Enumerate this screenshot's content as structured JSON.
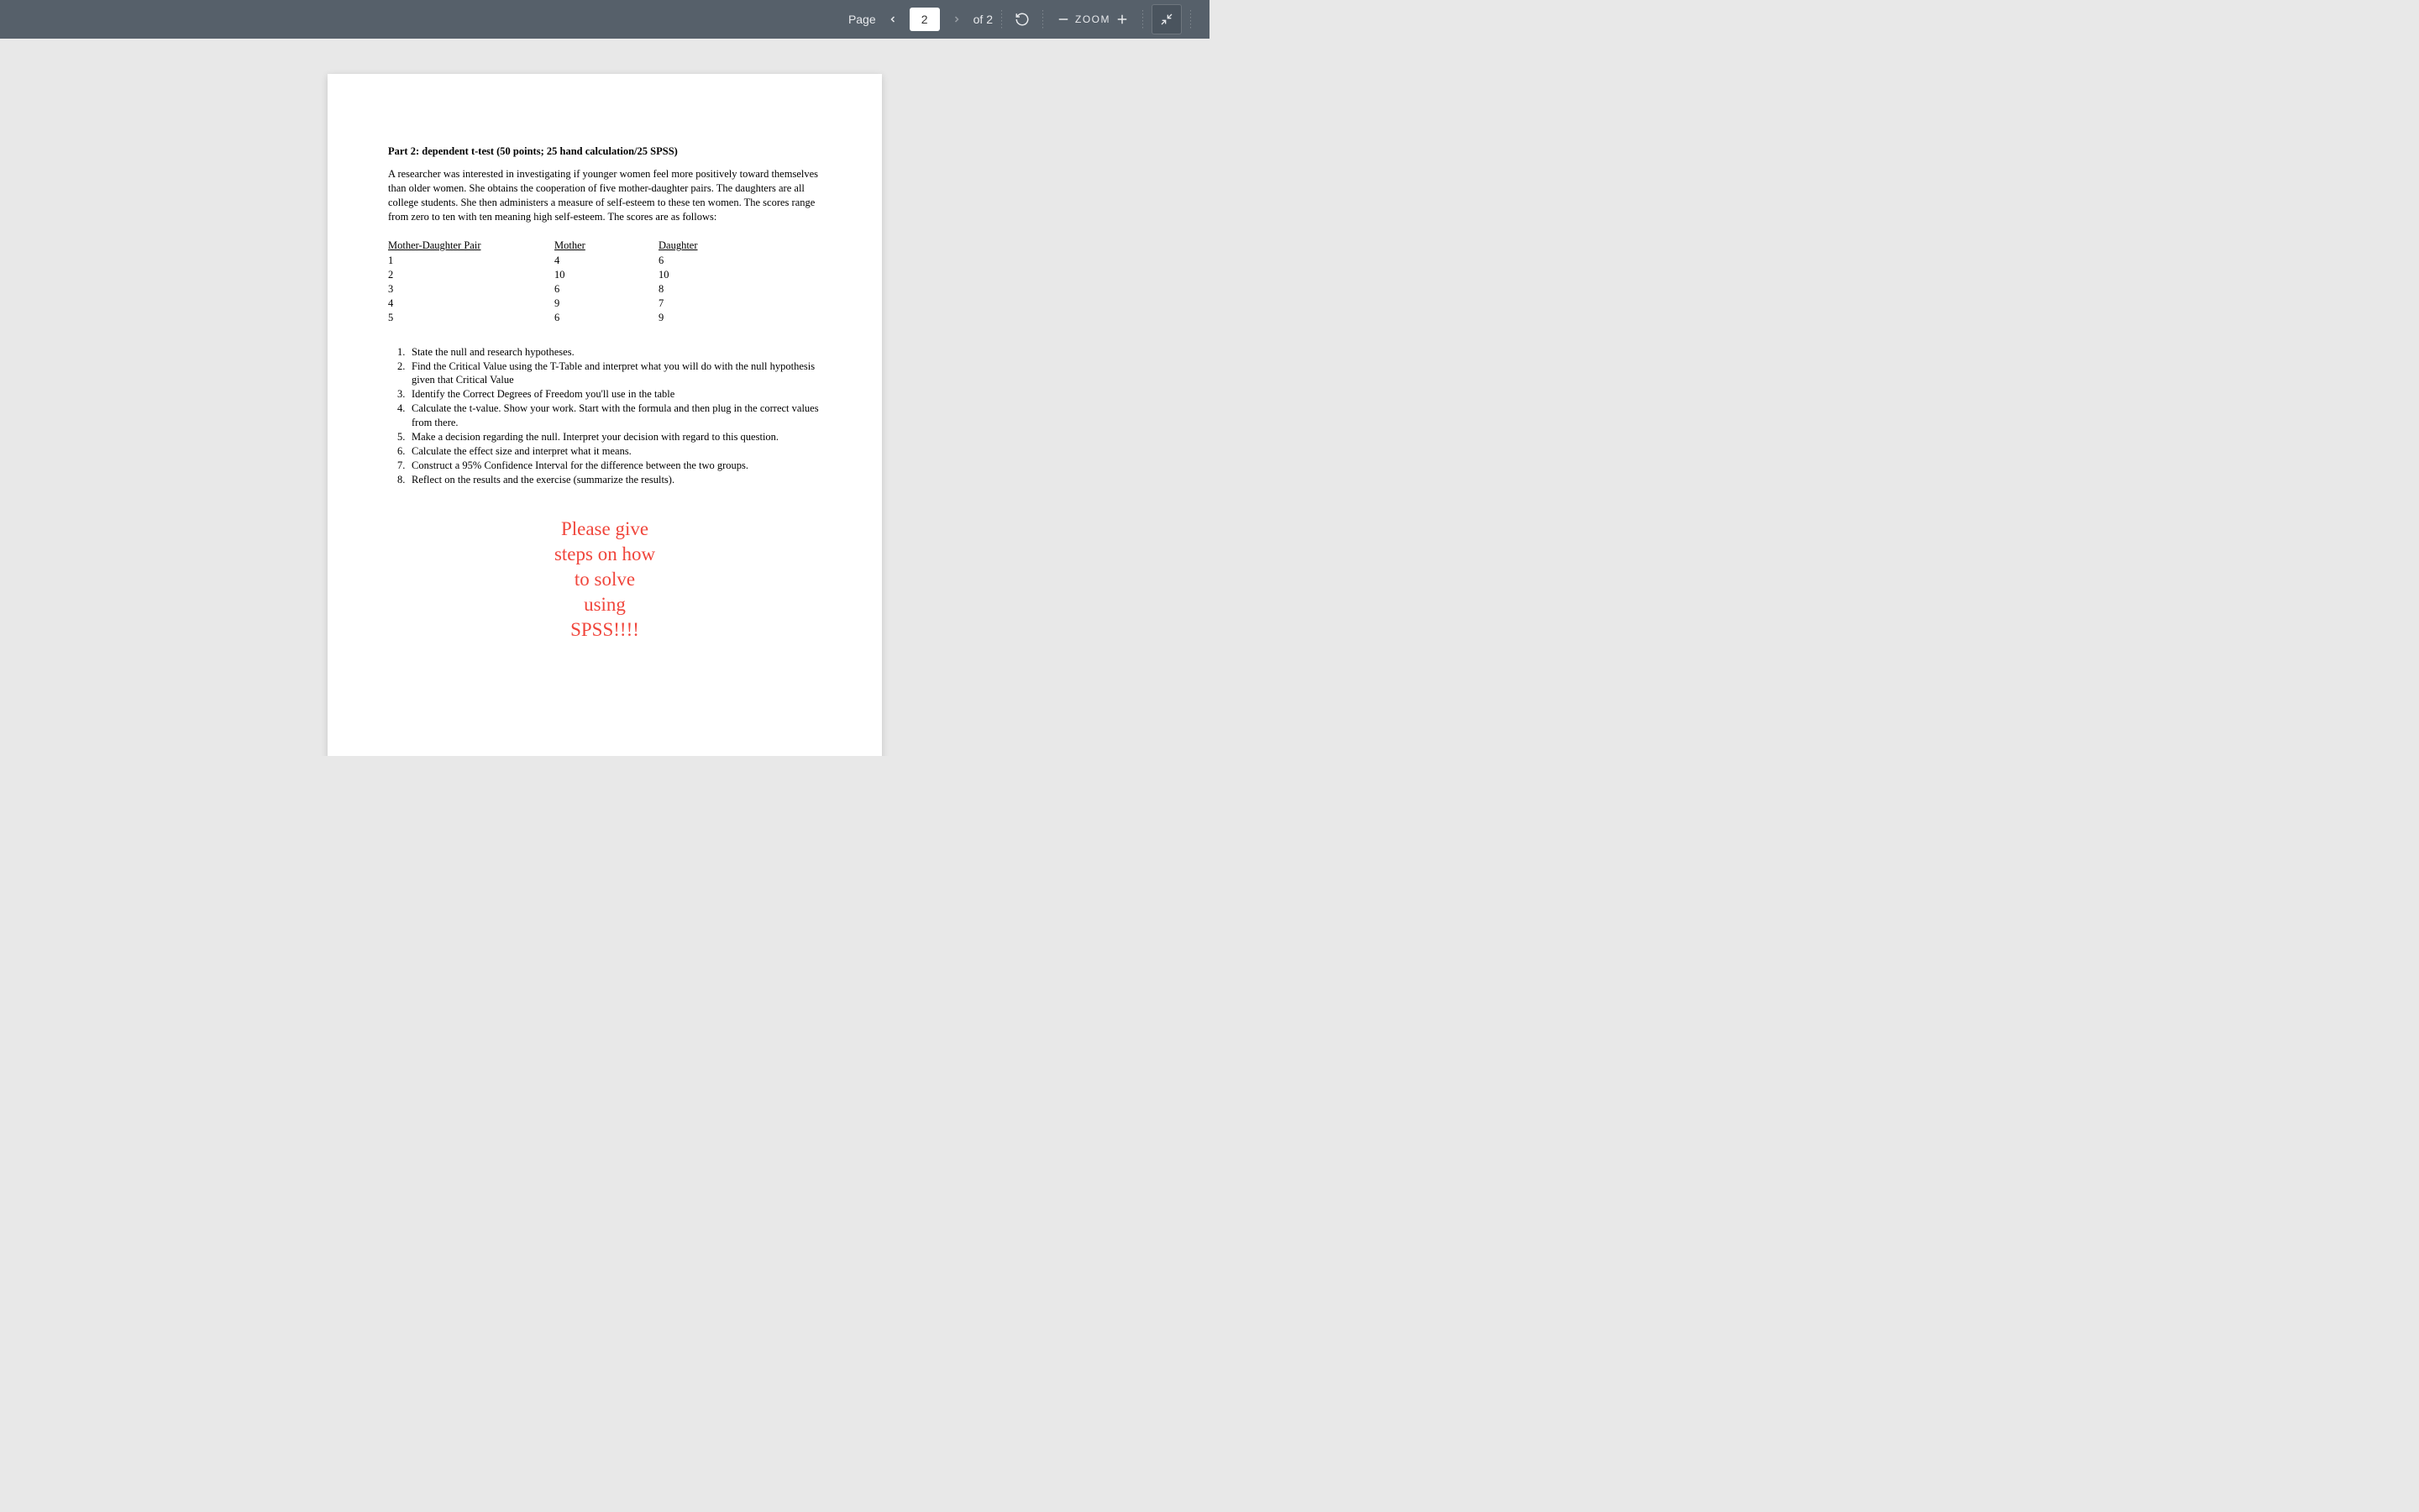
{
  "toolbar": {
    "page_label": "Page",
    "page_current": "2",
    "page_of": "of 2",
    "zoom_label": "ZOOM"
  },
  "doc": {
    "title": "Part 2: dependent t-test (50 points; 25 hand calculation/25 SPSS)",
    "paragraph": "A researcher was interested in investigating if younger women feel more positively toward themselves than older women. She obtains the cooperation of five mother-daughter pairs. The daughters are all college students. She then administers a measure of self-esteem to these ten women. The scores range from zero to ten with ten meaning high self-esteem. The scores are as follows:",
    "table": {
      "headers": [
        "Mother-Daughter Pair",
        "Mother",
        "Daughter"
      ],
      "rows": [
        [
          "1",
          "4",
          "6"
        ],
        [
          "2",
          "10",
          "10"
        ],
        [
          "3",
          "6",
          "8"
        ],
        [
          "4",
          "9",
          "7"
        ],
        [
          "5",
          "6",
          "9"
        ]
      ]
    },
    "questions": [
      "State the null and research hypotheses.",
      "Find the Critical Value using the T-Table and interpret what you will do with the null hypothesis given that Critical Value",
      "Identify the Correct Degrees of Freedom you'll use in the table",
      "Calculate the t-value.  Show your work.  Start with the formula and then plug in the correct values from there.",
      "Make a decision regarding the null.  Interpret your decision with regard to this question.",
      "Calculate the effect size and interpret what it means.",
      "Construct a 95% Confidence Interval for the difference between the two groups.",
      "Reflect on the results and the exercise (summarize the results)."
    ],
    "callout": [
      "Please give",
      "steps on how",
      "to solve",
      "using",
      "SPSS!!!!"
    ]
  }
}
